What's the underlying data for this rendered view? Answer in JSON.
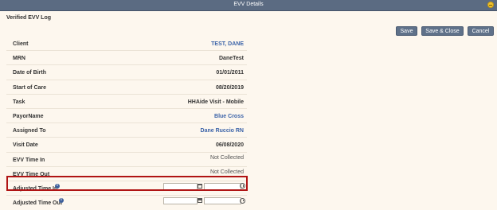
{
  "window": {
    "title": "EVV Details"
  },
  "page": {
    "heading": "Verified EVV Log"
  },
  "toolbar": {
    "save_label": "Save",
    "save_close_label": "Save & Close",
    "cancel_label": "Cancel"
  },
  "fields": [
    {
      "label": "Client",
      "value": "TEST, DANE",
      "style": "link"
    },
    {
      "label": "MRN",
      "value": "DaneTest",
      "style": "bold"
    },
    {
      "label": "Date of Birth",
      "value": "01/01/2011",
      "style": "bold"
    },
    {
      "label": "Start of Care",
      "value": "08/20/2019",
      "style": "bold"
    },
    {
      "label": "Task",
      "value": "HHAide Visit - Mobile",
      "style": "bold"
    },
    {
      "label": "PayorName",
      "value": "Blue Cross",
      "style": "link"
    },
    {
      "label": "Assigned To",
      "value": "Dane Ruccio RN",
      "style": "link"
    },
    {
      "label": "Visit Date",
      "value": "06/08/2020",
      "style": "bold"
    },
    {
      "label": "EVV Time In",
      "value": "Not Collected",
      "style": "muted"
    },
    {
      "label": "EVV Time Out",
      "value": "Not Collected",
      "style": "muted"
    }
  ],
  "adjusted": [
    {
      "label": "Adjusted Time In",
      "date_value": "",
      "time_value": ""
    },
    {
      "label": "Adjusted Time Out",
      "date_value": "",
      "time_value": ""
    }
  ],
  "icons": {
    "info": "info-icon",
    "calendar": "calendar-icon",
    "clock": "clock-icon",
    "minimize": "minimize-icon"
  },
  "colors": {
    "titlebar": "#5b6b82",
    "button": "#5f7189",
    "link": "#3b63a8",
    "highlight": "#b01414",
    "background": "#fdf7ee"
  }
}
